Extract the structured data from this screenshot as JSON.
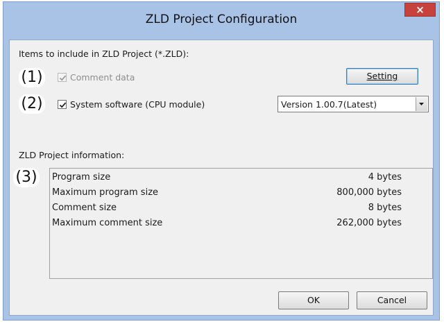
{
  "window": {
    "title": "ZLD Project Configuration",
    "close_label": "×"
  },
  "section_items": {
    "heading": "Items to include in ZLD Project (*.ZLD):",
    "comment_data": {
      "label": "Comment data",
      "checked": true,
      "enabled": false
    },
    "system_software": {
      "label": "System software (CPU module)",
      "checked": true,
      "enabled": true
    },
    "setting_button": "Setting",
    "version_select": {
      "value": "Version 1.00.7(Latest)"
    }
  },
  "section_info": {
    "heading": "ZLD Project information:",
    "rows": [
      {
        "name": "Program size",
        "value": "4 bytes"
      },
      {
        "name": "Maximum program size",
        "value": "800,000 bytes"
      },
      {
        "name": "Comment size",
        "value": "8 bytes"
      },
      {
        "name": "Maximum comment size",
        "value": "262,000 bytes"
      }
    ]
  },
  "callouts": [
    "(1)",
    "(2)",
    "(3)"
  ],
  "buttons": {
    "ok": "OK",
    "cancel": "Cancel"
  }
}
